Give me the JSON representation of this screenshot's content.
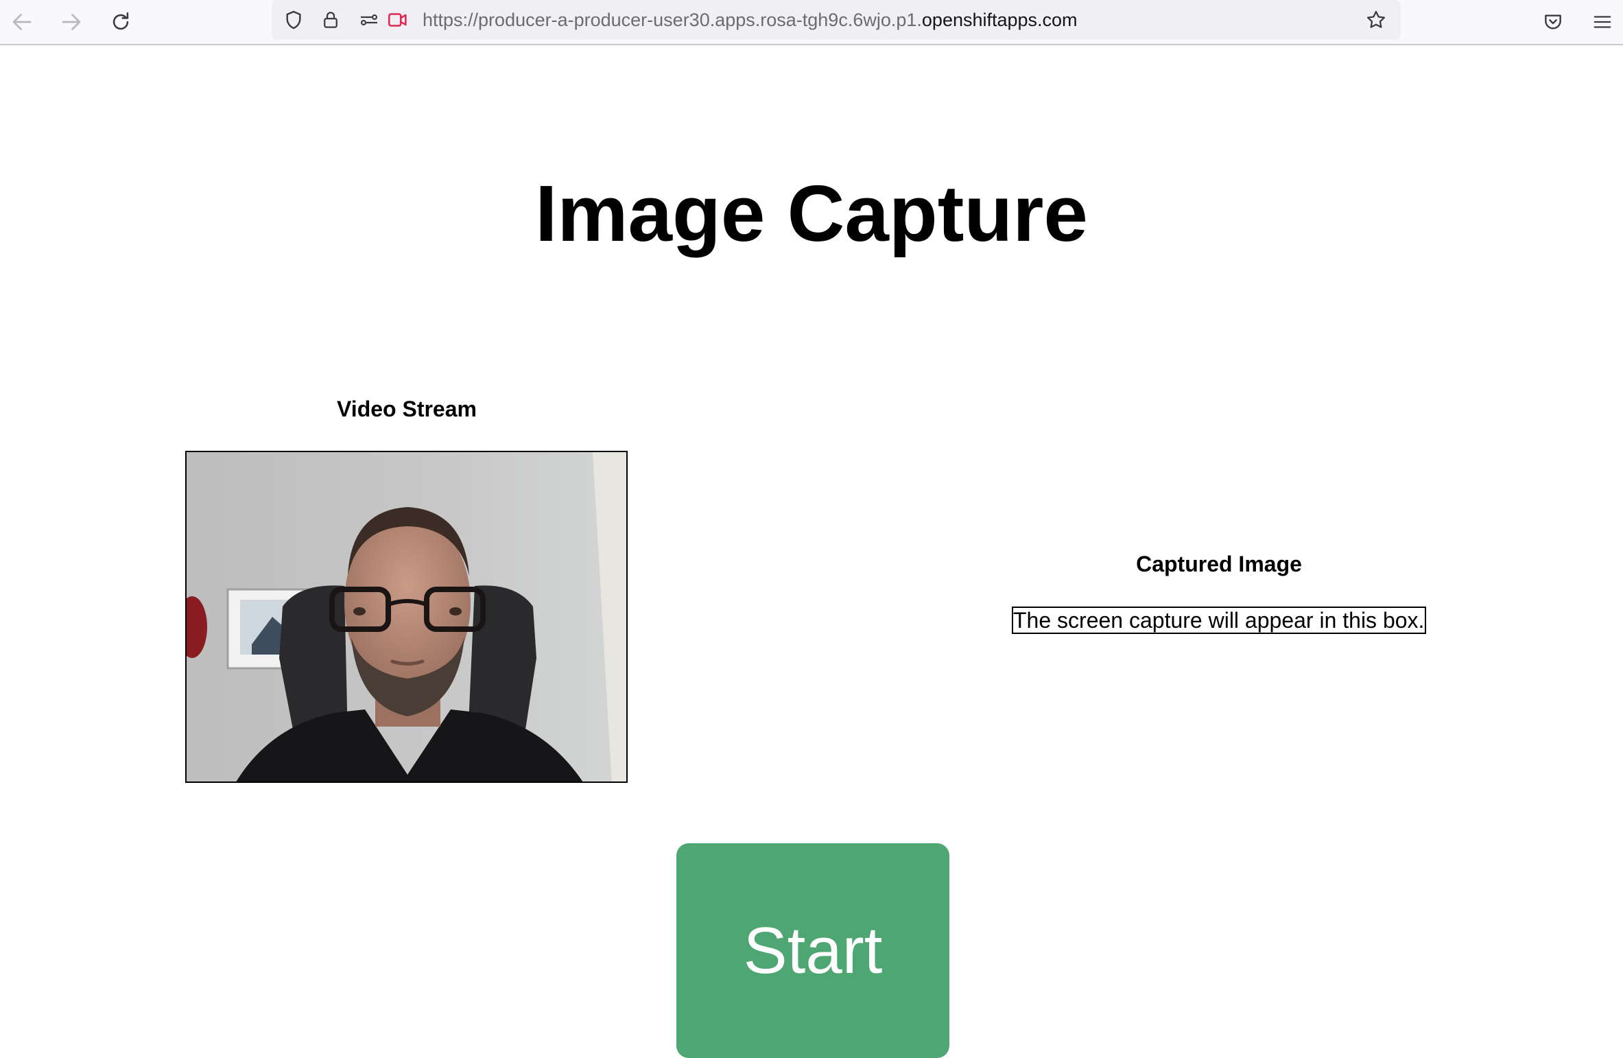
{
  "browser": {
    "url_prefix": "https://producer-a-producer-user30.apps.rosa-tgh9c.6wjo.p1.",
    "url_domain": "openshiftapps.com",
    "icons": [
      "back-icon",
      "forward-icon",
      "reload-icon",
      "shield-icon",
      "lock-icon",
      "permissions-icon",
      "camera-sharing-icon",
      "bookmark-star-icon",
      "pocket-icon",
      "menu-icon"
    ],
    "camera_indicator_color": "#e22850"
  },
  "page": {
    "title": "Image Capture",
    "video_section": {
      "heading": "Video Stream"
    },
    "capture_section": {
      "heading": "Captured Image",
      "placeholder": "The screen capture will appear in this box."
    },
    "start_button": {
      "label": "Start",
      "color": "#4ea673"
    }
  }
}
